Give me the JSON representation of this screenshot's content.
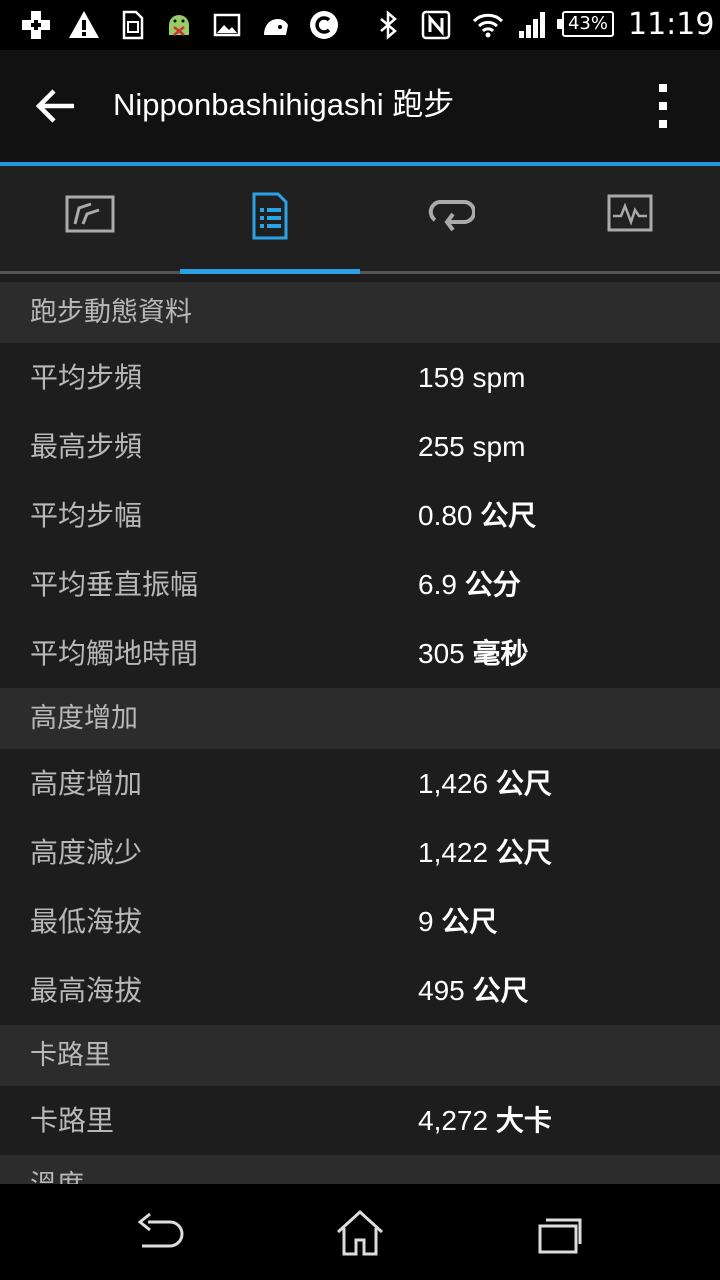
{
  "status_bar": {
    "battery": "43%",
    "time": "11:19"
  },
  "action_bar": {
    "title": "Nipponbashihigashi 跑步"
  },
  "sections": [
    {
      "header": "跑步動態資料",
      "rows": [
        {
          "label": "平均步頻",
          "value": "159 spm",
          "unit": ""
        },
        {
          "label": "最高步頻",
          "value": "255 spm",
          "unit": ""
        },
        {
          "label": "平均步幅",
          "value": "0.80 ",
          "unit": "公尺"
        },
        {
          "label": "平均垂直振幅",
          "value": "6.9 ",
          "unit": "公分"
        },
        {
          "label": "平均觸地時間",
          "value": "305 ",
          "unit": "毫秒"
        }
      ]
    },
    {
      "header": "高度增加",
      "rows": [
        {
          "label": "高度增加",
          "value": "1,426 ",
          "unit": "公尺"
        },
        {
          "label": "高度減少",
          "value": "1,422 ",
          "unit": "公尺"
        },
        {
          "label": "最低海拔",
          "value": "9 ",
          "unit": "公尺"
        },
        {
          "label": "最高海拔",
          "value": "495 ",
          "unit": "公尺"
        }
      ]
    },
    {
      "header": "卡路里",
      "rows": [
        {
          "label": "卡路里",
          "value": "4,272 ",
          "unit": "大卡"
        }
      ]
    },
    {
      "header": "溫度",
      "rows": []
    }
  ],
  "colors": {
    "accent": "#2196d8",
    "tab_active": "#2aa3e6",
    "background": "#1d1d1d",
    "section_header_bg": "#2c2c2c"
  }
}
